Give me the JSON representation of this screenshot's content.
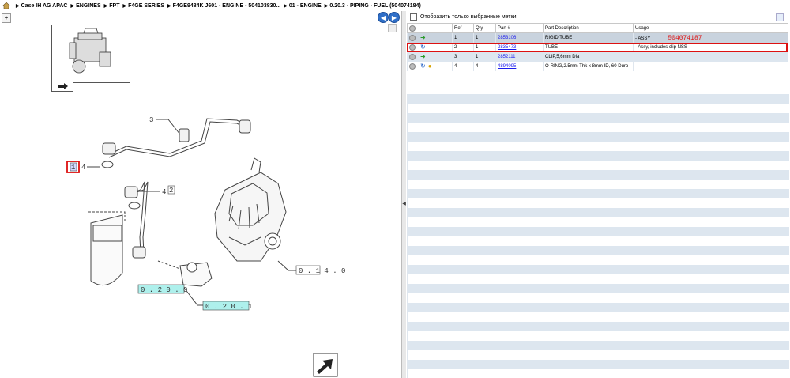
{
  "breadcrumb": {
    "items": [
      "Case IH AG APAC",
      "ENGINES",
      "FPT",
      "F4GE SERIES",
      "F4GE9484K J601 - ENGINE - 504103830...",
      "01 - ENGINE",
      "0.20.3 - PIPING - FUEL  (504074184)"
    ]
  },
  "filter": {
    "label": "Отобразить только выбранные метки"
  },
  "table": {
    "headers": [
      "",
      "",
      "Ref",
      "Qty",
      "Part #",
      "Part Description",
      "Usage"
    ],
    "rows": [
      {
        "ref": "1",
        "qty": "1",
        "part": "2853106",
        "desc": "RIGID TUBE",
        "usage": "- ASSY",
        "tag": "504074187",
        "icon": "green-arrow-icon"
      },
      {
        "ref": "2",
        "qty": "1",
        "part": "2835473",
        "desc": "TUBE",
        "usage": "- Assy, includes clip NSS",
        "tag": "",
        "icon": "blue-swap-icon"
      },
      {
        "ref": "3",
        "qty": "1",
        "part": "2852111",
        "desc": "CLIP,5,6mm Dia",
        "usage": "",
        "tag": "",
        "icon": "green-arrow-icon"
      },
      {
        "ref": "4",
        "qty": "4",
        "part": "4894095",
        "desc": "O-RING,2.5mm Thk x 8mm ID, 60 Duro",
        "usage": "",
        "tag": "",
        "icon": "blue-swap-icon"
      }
    ]
  },
  "drawing": {
    "callouts": [
      "1",
      "2",
      "3",
      "4",
      "4"
    ],
    "refs": [
      "0 . 1 4 . 0",
      "0 . 2 0 . 0",
      "0 . 2 0 . 1"
    ]
  },
  "colors": {
    "selection_border": "#dd1111",
    "link": "#1a1aee",
    "row_alt": "#dde6ef",
    "ref_box": "#aef0ec"
  }
}
